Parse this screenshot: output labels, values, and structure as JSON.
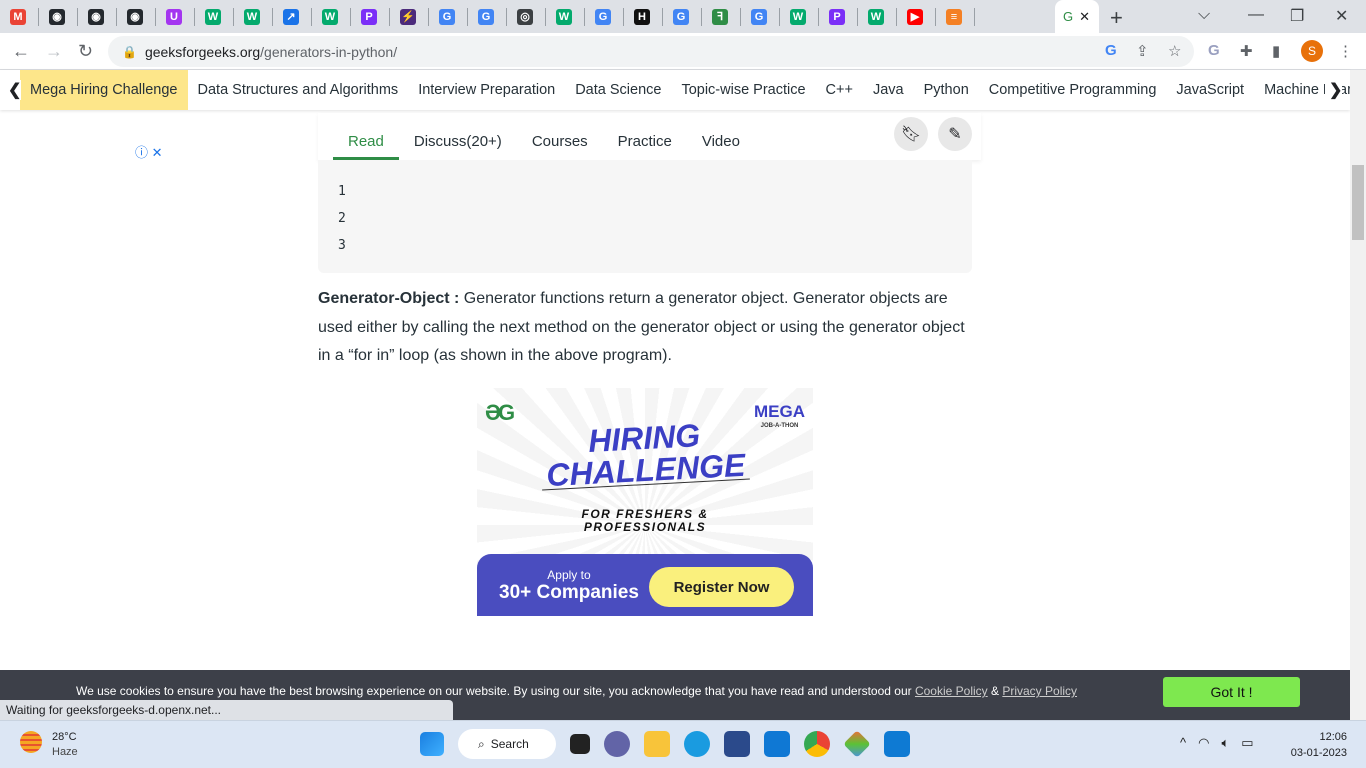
{
  "browser": {
    "tabs": [
      {
        "icon": "gmail-icon",
        "color": "#ea4335",
        "glyph": "M"
      },
      {
        "icon": "github-icon",
        "color": "#24292e",
        "glyph": "◉"
      },
      {
        "icon": "github-icon",
        "color": "#24292e",
        "glyph": "◉"
      },
      {
        "icon": "github-icon",
        "color": "#24292e",
        "glyph": "◉"
      },
      {
        "icon": "udemy-icon",
        "color": "#a435f0",
        "glyph": "U"
      },
      {
        "icon": "w3schools-icon",
        "color": "#04aa6d",
        "glyph": "W"
      },
      {
        "icon": "w3schools-icon",
        "color": "#04aa6d",
        "glyph": "W"
      },
      {
        "icon": "chart-icon",
        "color": "#1a73e8",
        "glyph": "↗"
      },
      {
        "icon": "w3schools-icon",
        "color": "#04aa6d",
        "glyph": "W"
      },
      {
        "icon": "p-icon",
        "color": "#7b2ff7",
        "glyph": "P"
      },
      {
        "icon": "bolt-icon",
        "color": "#4b2a7b",
        "glyph": "⚡"
      },
      {
        "icon": "google-icon",
        "color": "#4285f4",
        "glyph": "G"
      },
      {
        "icon": "google-icon",
        "color": "#4285f4",
        "glyph": "G"
      },
      {
        "icon": "chrome-icon",
        "color": "#3c4043",
        "glyph": "◎"
      },
      {
        "icon": "w3schools-icon",
        "color": "#04aa6d",
        "glyph": "W"
      },
      {
        "icon": "google-icon",
        "color": "#4285f4",
        "glyph": "G"
      },
      {
        "icon": "hackerrank-icon",
        "color": "#111",
        "glyph": "H"
      },
      {
        "icon": "google-icon",
        "color": "#4285f4",
        "glyph": "G"
      },
      {
        "icon": "geeksforgeeks-icon",
        "color": "#2f8d46",
        "glyph": "ꟻ"
      },
      {
        "icon": "google-icon",
        "color": "#4285f4",
        "glyph": "G"
      },
      {
        "icon": "w3schools-icon",
        "color": "#04aa6d",
        "glyph": "W"
      },
      {
        "icon": "p-icon",
        "color": "#7b2ff7",
        "glyph": "P"
      },
      {
        "icon": "w3schools-icon",
        "color": "#04aa6d",
        "glyph": "W"
      },
      {
        "icon": "youtube-icon",
        "color": "#ff0000",
        "glyph": "▶"
      },
      {
        "icon": "stackoverflow-icon",
        "color": "#f48024",
        "glyph": "≡"
      }
    ],
    "url_domain": "geeksforgeeks.org",
    "url_path": "/generators-in-python/",
    "profile_initial": "S",
    "status": "Waiting for geeksforgeeks-d.openx.net..."
  },
  "gfg_nav": [
    "Mega Hiring Challenge",
    "Data Structures and Algorithms",
    "Interview Preparation",
    "Data Science",
    "Topic-wise Practice",
    "C++",
    "Java",
    "Python",
    "Competitive Programming",
    "JavaScript",
    "Machine Learning"
  ],
  "article_tabs": [
    "Read",
    "Discuss(20+)",
    "Courses",
    "Practice",
    "Video"
  ],
  "code_output": [
    "1",
    "2",
    "3"
  ],
  "paragraph": {
    "term": "Generator-Object :",
    "text": " Generator functions return a generator object. Generator objects are used either by calling the next method on the generator object or using the generator object in a “for in” loop (as shown in the above program)."
  },
  "ad": {
    "logo": "ƏG",
    "mega": "MEGA",
    "mega_sub": "JOB-A-THON",
    "title1": "HIRING",
    "title2": "CHALLENGE",
    "sub1": "FOR  FRESHERS &",
    "sub2": "PROFESSIONALS",
    "apply": "Apply to",
    "companies": "30+ Companies",
    "cta": "Register Now",
    "accent": "#3b3fc4"
  },
  "cookie": {
    "text": "We use cookies to ensure you have the best browsing experience on our website. By using our site, you acknowledge that you have read and understood our ",
    "cookie_policy": "Cookie Policy",
    "amp": " & ",
    "privacy_policy": "Privacy Policy",
    "button": "Got It !"
  },
  "taskbar": {
    "temp": "28°C",
    "weather": "Haze",
    "search": "Search",
    "time": "12:06",
    "date": "03-01-2023"
  }
}
